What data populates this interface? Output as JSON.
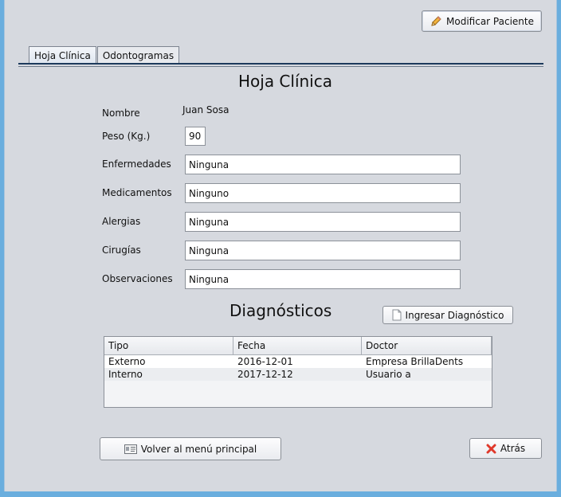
{
  "header": {
    "modify_label": "Modificar Paciente"
  },
  "tabs": [
    {
      "label": "Hoja Clínica",
      "active": true
    },
    {
      "label": "Odontogramas",
      "active": false
    }
  ],
  "form": {
    "title": "Hoja Clínica",
    "name_label": "Nombre",
    "name_value": "Juan Sosa",
    "weight_label": "Peso (Kg.)",
    "weight_value": "90",
    "diseases_label": "Enfermedades",
    "diseases_value": "Ninguna",
    "medications_label": "Medicamentos",
    "medications_value": "Ninguno",
    "allergies_label": "Alergias",
    "allergies_value": "Ninguna",
    "surgeries_label": "Cirugías",
    "surgeries_value": "Ninguna",
    "observations_label": "Observaciones",
    "observations_value": "Ninguna"
  },
  "diagnostics": {
    "title": "Diagnósticos",
    "add_label": "Ingresar Diagnóstico",
    "columns": [
      "Tipo",
      "Fecha",
      "Doctor"
    ],
    "rows": [
      [
        "Externo",
        "2016-12-01",
        "Empresa BrillaDents"
      ],
      [
        "Interno",
        "2017-12-12",
        "Usuario a"
      ]
    ]
  },
  "footer": {
    "back_menu_label": "Volver al menú principal",
    "back_label": "Atrás"
  },
  "icons": {
    "modify": "pencil-icon",
    "add_diagnosis": "document-icon",
    "back_menu": "id-card-icon",
    "back": "red-x-icon"
  },
  "colors": {
    "background": "#d6d9df",
    "outer_frame": "#6aaede",
    "tab_underline": "#1d3a5c",
    "close_icon": "#e0392b"
  }
}
